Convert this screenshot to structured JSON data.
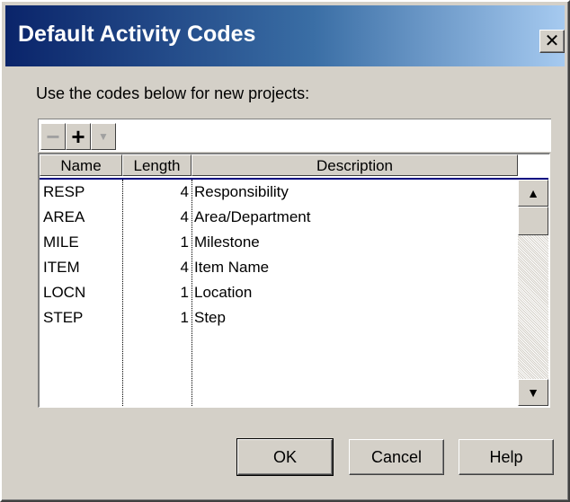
{
  "window": {
    "title": "Default Activity Codes",
    "close_glyph": "✕"
  },
  "instruction": "Use the codes below for new projects:",
  "toolbar": {
    "minus_glyph": "−",
    "plus_glyph": "+",
    "dropdown_glyph": "▼"
  },
  "grid": {
    "columns": [
      "Name",
      "Length",
      "Description"
    ],
    "rows": [
      {
        "name": "RESP",
        "length": "4",
        "description": "Responsibility"
      },
      {
        "name": "AREA",
        "length": "4",
        "description": "Area/Department"
      },
      {
        "name": "MILE",
        "length": "1",
        "description": "Milestone"
      },
      {
        "name": "ITEM",
        "length": "4",
        "description": "Item Name"
      },
      {
        "name": "LOCN",
        "length": "1",
        "description": "Location"
      },
      {
        "name": "STEP",
        "length": "1",
        "description": "Step"
      }
    ]
  },
  "scrollbar": {
    "up_glyph": "▲",
    "down_glyph": "▼"
  },
  "buttons": {
    "ok": "OK",
    "cancel": "Cancel",
    "help": "Help"
  },
  "colors": {
    "title_start": "#0a246a",
    "title_end": "#a6caf0",
    "face": "#d4d0c8"
  }
}
